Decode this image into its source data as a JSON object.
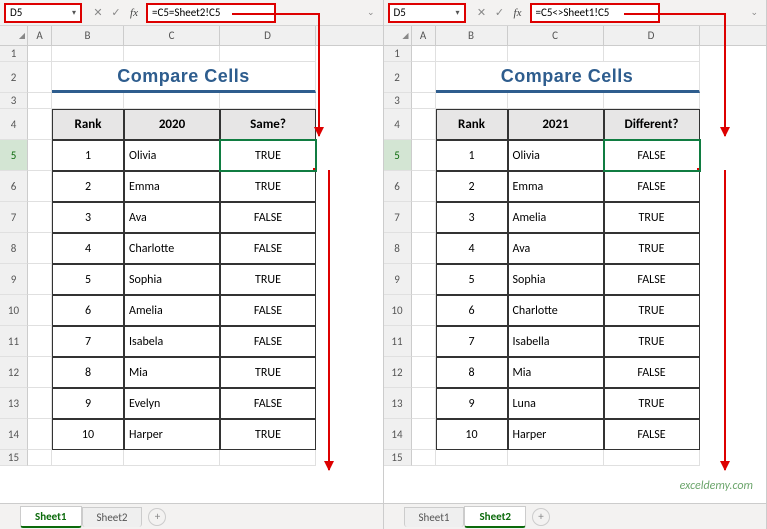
{
  "left": {
    "cell_ref": "D5",
    "formula": "=C5=Sheet2!C5",
    "columns": [
      "A",
      "B",
      "C",
      "D"
    ],
    "title": "Compare Cells",
    "headers": {
      "rank": "Rank",
      "year": "2020",
      "result": "Same?"
    },
    "rows": [
      {
        "n": 5,
        "rank": "1",
        "name": "Olivia",
        "val": "TRUE"
      },
      {
        "n": 6,
        "rank": "2",
        "name": "Emma",
        "val": "TRUE"
      },
      {
        "n": 7,
        "rank": "3",
        "name": "Ava",
        "val": "FALSE"
      },
      {
        "n": 8,
        "rank": "4",
        "name": "Charlotte",
        "val": "FALSE"
      },
      {
        "n": 9,
        "rank": "5",
        "name": "Sophia",
        "val": "TRUE"
      },
      {
        "n": 10,
        "rank": "6",
        "name": "Amelia",
        "val": "FALSE"
      },
      {
        "n": 11,
        "rank": "7",
        "name": "Isabela",
        "val": "FALSE"
      },
      {
        "n": 12,
        "rank": "8",
        "name": "Mia",
        "val": "TRUE"
      },
      {
        "n": 13,
        "rank": "9",
        "name": "Evelyn",
        "val": "FALSE"
      },
      {
        "n": 14,
        "rank": "10",
        "name": "Harper",
        "val": "TRUE"
      }
    ],
    "tabs": [
      "Sheet1",
      "Sheet2"
    ],
    "active_tab": "Sheet1"
  },
  "right": {
    "cell_ref": "D5",
    "formula": "=C5<>Sheet1!C5",
    "columns": [
      "A",
      "B",
      "C",
      "D"
    ],
    "title": "Compare Cells",
    "headers": {
      "rank": "Rank",
      "year": "2021",
      "result": "Different?"
    },
    "rows": [
      {
        "n": 5,
        "rank": "1",
        "name": "Olivia",
        "val": "FALSE"
      },
      {
        "n": 6,
        "rank": "2",
        "name": "Emma",
        "val": "FALSE"
      },
      {
        "n": 7,
        "rank": "3",
        "name": "Amelia",
        "val": "TRUE"
      },
      {
        "n": 8,
        "rank": "4",
        "name": "Ava",
        "val": "TRUE"
      },
      {
        "n": 9,
        "rank": "5",
        "name": "Sophia",
        "val": "FALSE"
      },
      {
        "n": 10,
        "rank": "6",
        "name": "Charlotte",
        "val": "TRUE"
      },
      {
        "n": 11,
        "rank": "7",
        "name": "Isabella",
        "val": "TRUE"
      },
      {
        "n": 12,
        "rank": "8",
        "name": "Mia",
        "val": "FALSE"
      },
      {
        "n": 13,
        "rank": "9",
        "name": "Luna",
        "val": "TRUE"
      },
      {
        "n": 14,
        "rank": "10",
        "name": "Harper",
        "val": "FALSE"
      }
    ],
    "tabs": [
      "Sheet1",
      "Sheet2"
    ],
    "active_tab": "Sheet2"
  },
  "watermark": "exceldemy.com"
}
